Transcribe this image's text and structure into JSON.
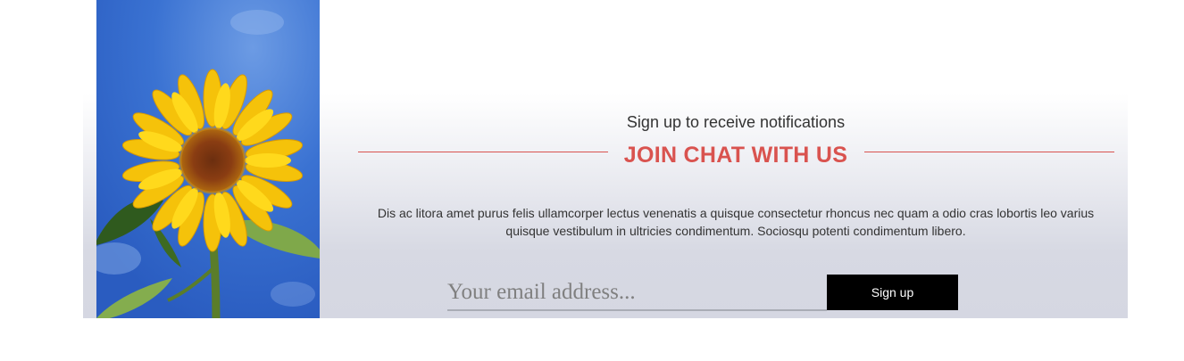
{
  "photo": {
    "subject": "sunflower",
    "sky_color": "#3a74d4"
  },
  "signup": {
    "kicker": "Sign up to receive notifications",
    "title": "JOIN CHAT WITH US",
    "description": "Dis ac litora amet purus felis ullamcorper lectus venenatis a quisque consectetur rhoncus nec quam a odio cras lobortis leo varius quisque vestibulum in ultricies condimentum. Sociosqu potenti condimentum libero.",
    "email_placeholder": "Your email address...",
    "email_value": "",
    "button_label": "Sign up"
  },
  "colors": {
    "accent": "#d9534f",
    "button_bg": "#000000",
    "button_text": "#ffffff"
  }
}
